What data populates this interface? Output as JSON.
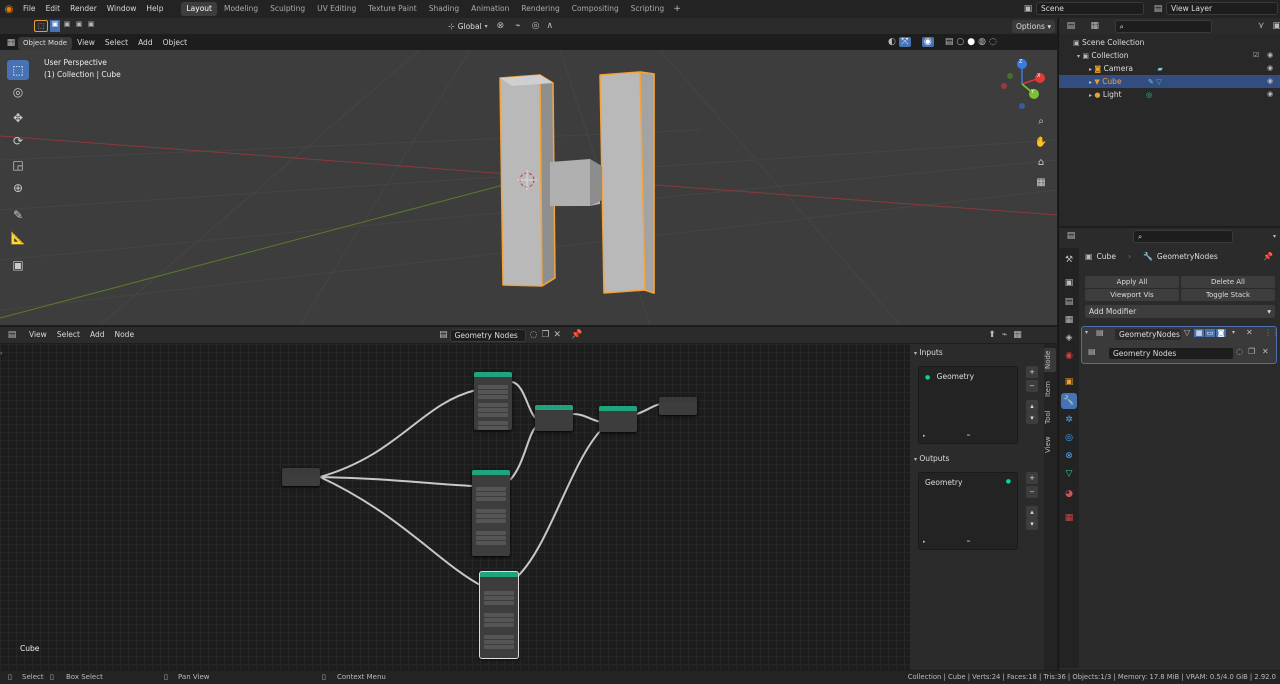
{
  "topbar": {
    "menus": [
      "File",
      "Edit",
      "Render",
      "Window",
      "Help"
    ],
    "workspaces": [
      "Layout",
      "Modeling",
      "Sculpting",
      "UV Editing",
      "Texture Paint",
      "Shading",
      "Animation",
      "Rendering",
      "Compositing",
      "Scripting"
    ],
    "active_workspace": "Layout",
    "scene": "Scene",
    "view_layer": "View Layer"
  },
  "viewport": {
    "mode": "Object Mode",
    "menus": [
      "View",
      "Select",
      "Add",
      "Object"
    ],
    "orientation": "Global",
    "options": "Options",
    "overlay_title": "User Perspective",
    "overlay_sub": "(1) Collection | Cube",
    "gizmo": {
      "x": "X",
      "y": "Y",
      "z": "Z"
    }
  },
  "outliner": {
    "root": "Scene Collection",
    "collection": "Collection",
    "items": [
      "Camera",
      "Cube",
      "Light"
    ],
    "selected": "Cube"
  },
  "properties": {
    "object": "Cube",
    "modifier_breadcrumb": "GeometryNodes",
    "apply_all": "Apply All",
    "delete_all": "Delete All",
    "viewport_vis": "Viewport Vis",
    "toggle_stack": "Toggle Stack",
    "add_modifier": "Add Modifier",
    "modifier_name": "GeometryNodes",
    "node_group": "Geometry Nodes"
  },
  "node_editor": {
    "menus": [
      "View",
      "Select",
      "Add",
      "Node"
    ],
    "tree_name": "Geometry Nodes",
    "object_label": "Cube",
    "inputs_title": "Inputs",
    "input_socket": "Geometry",
    "outputs_title": "Outputs",
    "output_socket": "Geometry",
    "side_tabs": [
      "Node",
      "Item",
      "Tool",
      "View"
    ]
  },
  "statusbar": {
    "select": "Select",
    "box_select": "Box Select",
    "pan_view": "Pan View",
    "context_menu": "Context Menu",
    "stats": "Collection | Cube | Verts:24 | Faces:18 | Tris:36 | Objects:1/3 | Memory: 17.8 MiB | VRAM: 0.5/4.0 GiB | 2.92.0"
  },
  "colors": {
    "accent": "#4772b3",
    "selection_outline": "#f5a33a",
    "node_header_green": "#1fa57d",
    "socket_green": "#00d6a3"
  }
}
